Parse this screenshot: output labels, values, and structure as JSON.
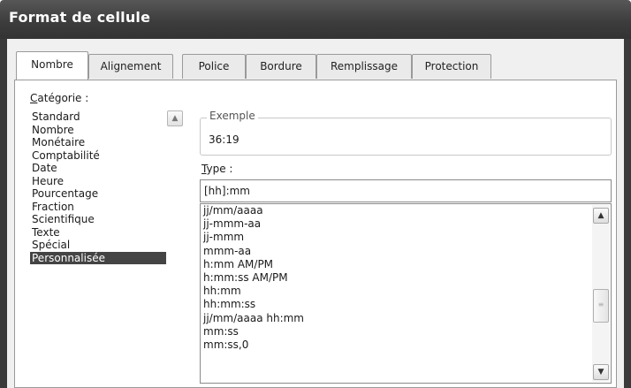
{
  "window": {
    "title": "Format de cellule"
  },
  "tabs": [
    {
      "label": "Nombre"
    },
    {
      "label": "Alignement"
    },
    {
      "label": "Police"
    },
    {
      "label": "Bordure"
    },
    {
      "label": "Remplissage"
    },
    {
      "label": "Protection"
    }
  ],
  "category": {
    "label_accel": "C",
    "label_rest": "atégorie :",
    "items": [
      "Standard",
      "Nombre",
      "Monétaire",
      "Comptabilité",
      "Date",
      "Heure",
      "Pourcentage",
      "Fraction",
      "Scientifique",
      "Texte",
      "Spécial",
      "Personnalisée"
    ],
    "selected": "Personnalisée"
  },
  "exemple": {
    "legend": "Exemple",
    "value": "36:19"
  },
  "type": {
    "label_accel": "T",
    "label_rest": "ype :",
    "input_value": "[hh]:mm",
    "items": [
      "jj/mm/aaaa",
      "jj-mmm-aa",
      "jj-mmm",
      "mmm-aa",
      "h:mm AM/PM",
      "h:mm:ss AM/PM",
      "hh:mm",
      "hh:mm:ss",
      "jj/mm/aaaa hh:mm",
      "mm:ss",
      "mm:ss,0"
    ]
  },
  "icons": {
    "scroll_up": "chevron-up-icon",
    "scroll_down": "chevron-down-icon",
    "scroll_thumb": "scroll-thumb-grip-icon"
  }
}
